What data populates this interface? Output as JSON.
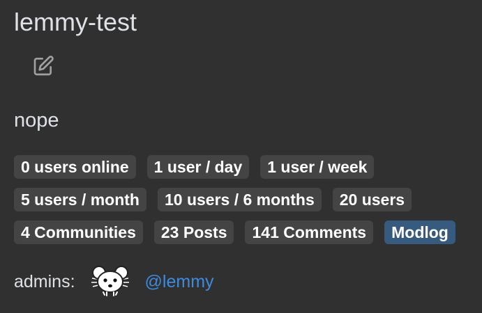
{
  "site": {
    "title": "lemmy-test",
    "description": "nope"
  },
  "icons": {
    "edit": "edit-icon",
    "avatar": "lemmy-mouse-avatar"
  },
  "stats": {
    "row1": [
      "0 users online",
      "1 user / day",
      "1 user / week"
    ],
    "row2": [
      "5 users / month",
      "10 users / 6 months",
      "20 users"
    ],
    "row3": [
      "4 Communities",
      "23 Posts",
      "141 Comments"
    ],
    "modlog": "Modlog"
  },
  "admins": {
    "label": "admins:",
    "users": [
      {
        "name": "@lemmy"
      }
    ]
  },
  "colors": {
    "background": "#303030",
    "badge": "#444444",
    "primary": "#375a7f",
    "link": "#3d8bde"
  }
}
